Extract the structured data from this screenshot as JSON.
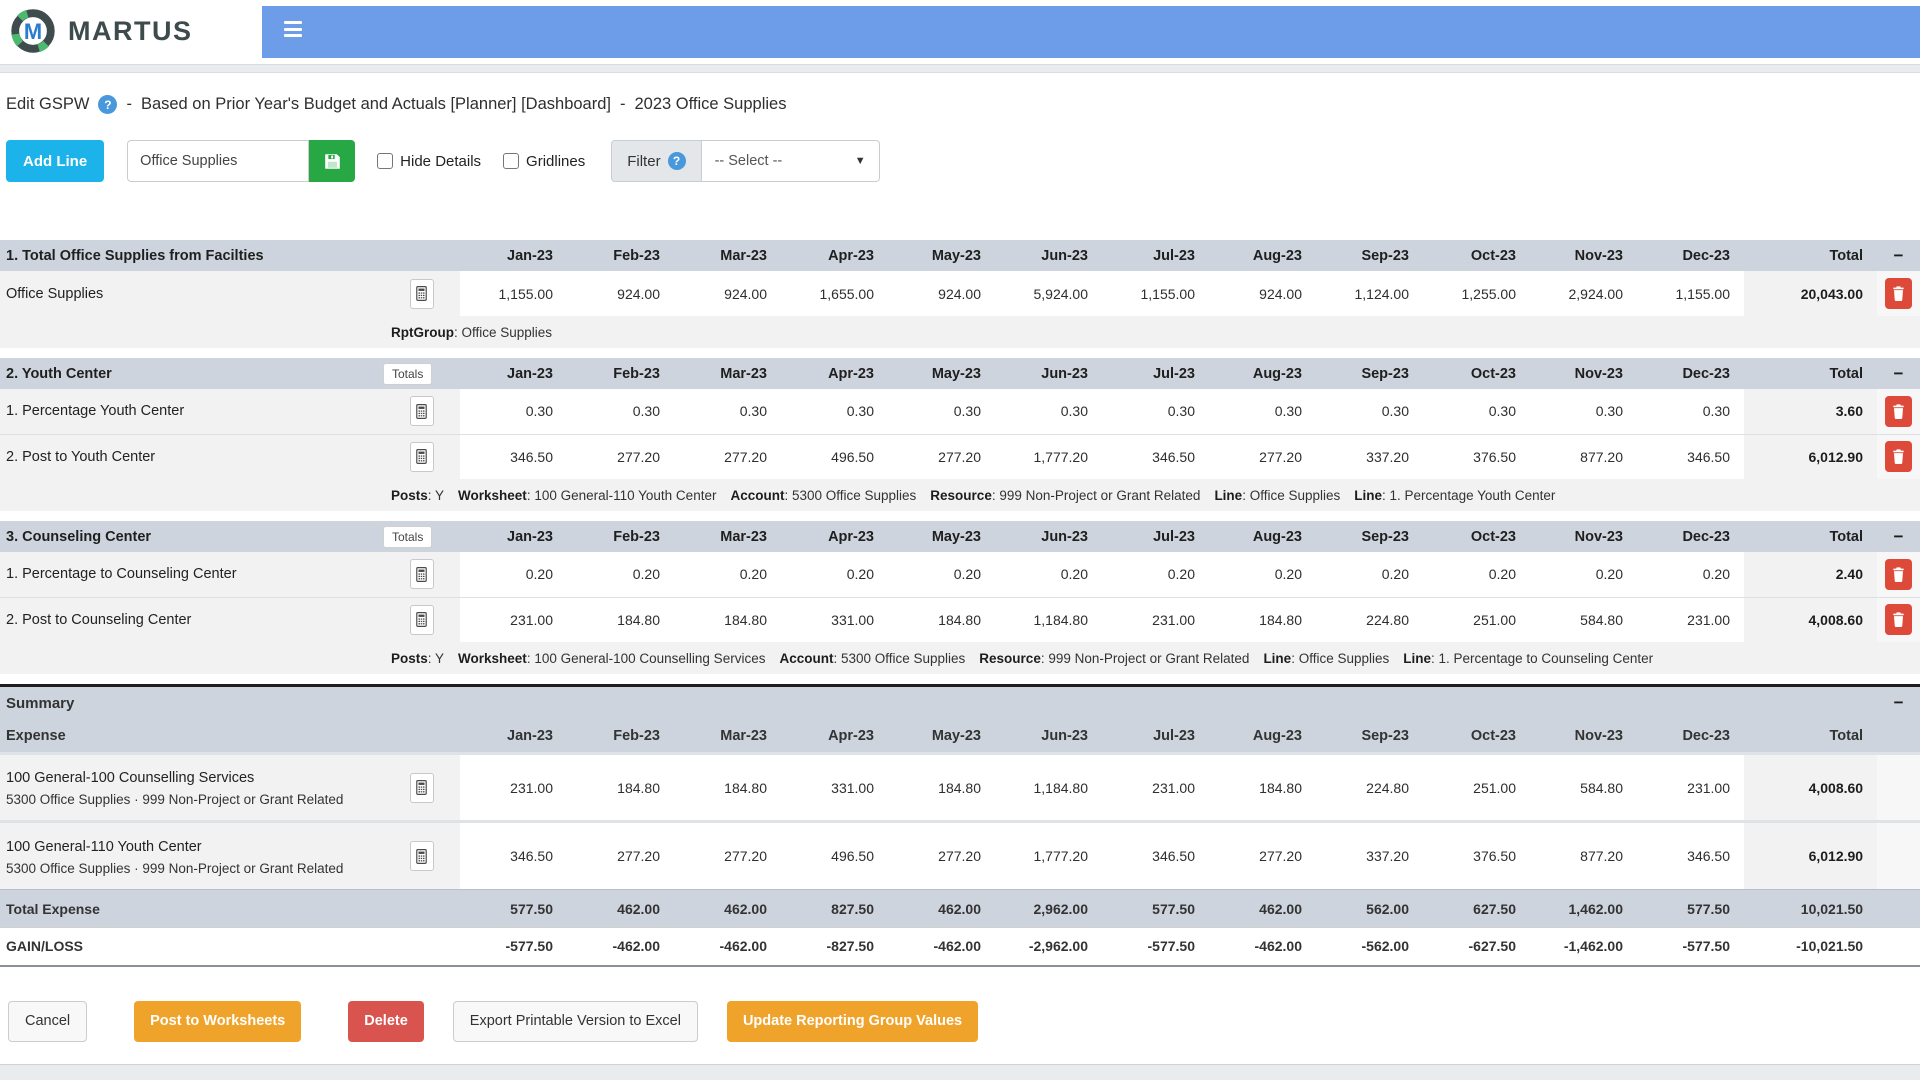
{
  "brand": {
    "name": "MARTUS"
  },
  "title": {
    "name": "Edit GSPW",
    "separator": "-",
    "description": "Based on Prior Year's Budget and Actuals [Planner] [Dashboard]",
    "suffix": "2023 Office Supplies"
  },
  "toolbar": {
    "add_line_label": "Add Line",
    "name_value": "Office Supplies",
    "hide_details_label": "Hide Details",
    "gridlines_label": "Gridlines",
    "filter_label": "Filter",
    "select_value": "-- Select --"
  },
  "table": {
    "months": [
      "Jan-23",
      "Feb-23",
      "Mar-23",
      "Apr-23",
      "May-23",
      "Jun-23",
      "Jul-23",
      "Aug-23",
      "Sep-23",
      "Oct-23",
      "Nov-23",
      "Dec-23"
    ],
    "total_label": "Total",
    "totals_badge_label": "Totals",
    "sections": [
      {
        "title": "1. Total Office Supplies from Facilties",
        "totals_badge": false,
        "rows": [
          {
            "label": "Office Supplies",
            "values": [
              "1,155.00",
              "924.00",
              "924.00",
              "1,655.00",
              "924.00",
              "5,924.00",
              "1,155.00",
              "924.00",
              "1,124.00",
              "1,255.00",
              "2,924.00",
              "1,155.00"
            ],
            "total": "20,043.00",
            "meta": [
              {
                "k": "RptGroup",
                "v": "Office Supplies"
              }
            ]
          }
        ]
      },
      {
        "title": "2. Youth Center",
        "totals_badge": true,
        "rows": [
          {
            "label": "1. Percentage Youth Center",
            "values": [
              "0.30",
              "0.30",
              "0.30",
              "0.30",
              "0.30",
              "0.30",
              "0.30",
              "0.30",
              "0.30",
              "0.30",
              "0.30",
              "0.30"
            ],
            "total": "3.60"
          },
          {
            "label": "2. Post to Youth Center",
            "values": [
              "346.50",
              "277.20",
              "277.20",
              "496.50",
              "277.20",
              "1,777.20",
              "346.50",
              "277.20",
              "337.20",
              "376.50",
              "877.20",
              "346.50"
            ],
            "total": "6,012.90",
            "meta": [
              {
                "k": "Posts",
                "v": "Y"
              },
              {
                "k": "Worksheet",
                "v": "100 General-110 Youth Center"
              },
              {
                "k": "Account",
                "v": "5300 Office Supplies"
              },
              {
                "k": "Resource",
                "v": "999 Non-Project or Grant Related"
              },
              {
                "k": "Line",
                "v": "Office Supplies"
              },
              {
                "k": "Line",
                "v": "1. Percentage Youth Center"
              }
            ]
          }
        ]
      },
      {
        "title": "3. Counseling Center",
        "totals_badge": true,
        "rows": [
          {
            "label": "1. Percentage to Counseling Center",
            "values": [
              "0.20",
              "0.20",
              "0.20",
              "0.20",
              "0.20",
              "0.20",
              "0.20",
              "0.20",
              "0.20",
              "0.20",
              "0.20",
              "0.20"
            ],
            "total": "2.40"
          },
          {
            "label": "2. Post to Counseling Center",
            "values": [
              "231.00",
              "184.80",
              "184.80",
              "331.00",
              "184.80",
              "1,184.80",
              "231.00",
              "184.80",
              "224.80",
              "251.00",
              "584.80",
              "231.00"
            ],
            "total": "4,008.60",
            "meta": [
              {
                "k": "Posts",
                "v": "Y"
              },
              {
                "k": "Worksheet",
                "v": "100 General-100 Counselling Services"
              },
              {
                "k": "Account",
                "v": "5300 Office Supplies"
              },
              {
                "k": "Resource",
                "v": "999 Non-Project or Grant Related"
              },
              {
                "k": "Line",
                "v": "Office Supplies"
              },
              {
                "k": "Line",
                "v": "1. Percentage to Counseling Center"
              }
            ]
          }
        ]
      }
    ],
    "summary": {
      "title": "Summary",
      "expense_label": "Expense",
      "rows": [
        {
          "label": "100 General-100 Counselling Services",
          "sublabel": "5300 Office Supplies · 999 Non-Project or Grant Related",
          "values": [
            "231.00",
            "184.80",
            "184.80",
            "331.00",
            "184.80",
            "1,184.80",
            "231.00",
            "184.80",
            "224.80",
            "251.00",
            "584.80",
            "231.00"
          ],
          "total": "4,008.60"
        },
        {
          "label": "100 General-110 Youth Center",
          "sublabel": "5300 Office Supplies · 999 Non-Project or Grant Related",
          "values": [
            "346.50",
            "277.20",
            "277.20",
            "496.50",
            "277.20",
            "1,777.20",
            "346.50",
            "277.20",
            "337.20",
            "376.50",
            "877.20",
            "346.50"
          ],
          "total": "6,012.90"
        }
      ],
      "total_row": {
        "label": "Total Expense",
        "values": [
          "577.50",
          "462.00",
          "462.00",
          "827.50",
          "462.00",
          "2,962.00",
          "577.50",
          "462.00",
          "562.00",
          "627.50",
          "1,462.00",
          "577.50"
        ],
        "total": "10,021.50"
      },
      "gainloss_row": {
        "label": "GAIN/LOSS",
        "values": [
          "-577.50",
          "-462.00",
          "-462.00",
          "-827.50",
          "-462.00",
          "-2,962.00",
          "-577.50",
          "-462.00",
          "-562.00",
          "-627.50",
          "-1,462.00",
          "-577.50"
        ],
        "total": "-10,021.50"
      }
    }
  },
  "footer": {
    "buttons": [
      {
        "label": "Cancel",
        "style": "light"
      },
      {
        "label": "Post to Worksheets",
        "style": "orange"
      },
      {
        "label": "Delete",
        "style": "red"
      },
      {
        "label": "Export Printable Version to Excel",
        "style": "light"
      },
      {
        "label": "Update Reporting Group Values",
        "style": "orange"
      }
    ]
  },
  "colors": {
    "nav_blue": "#6d9ce8",
    "add_line_cyan": "#1cb3ea",
    "save_green": "#28a745",
    "section_header_gray": "#ced4dd",
    "trash_red": "#dd4a3a",
    "button_orange": "#f0a32b",
    "button_red": "#d9534f"
  },
  "icons": {
    "menu": "hamburger-icon",
    "help": "question-circle-icon",
    "save": "floppy-disk-icon",
    "row_edit": "calculator-icon",
    "row_delete": "trash-icon",
    "collapse": "minus-icon",
    "dropdown": "chevron-down-icon"
  }
}
